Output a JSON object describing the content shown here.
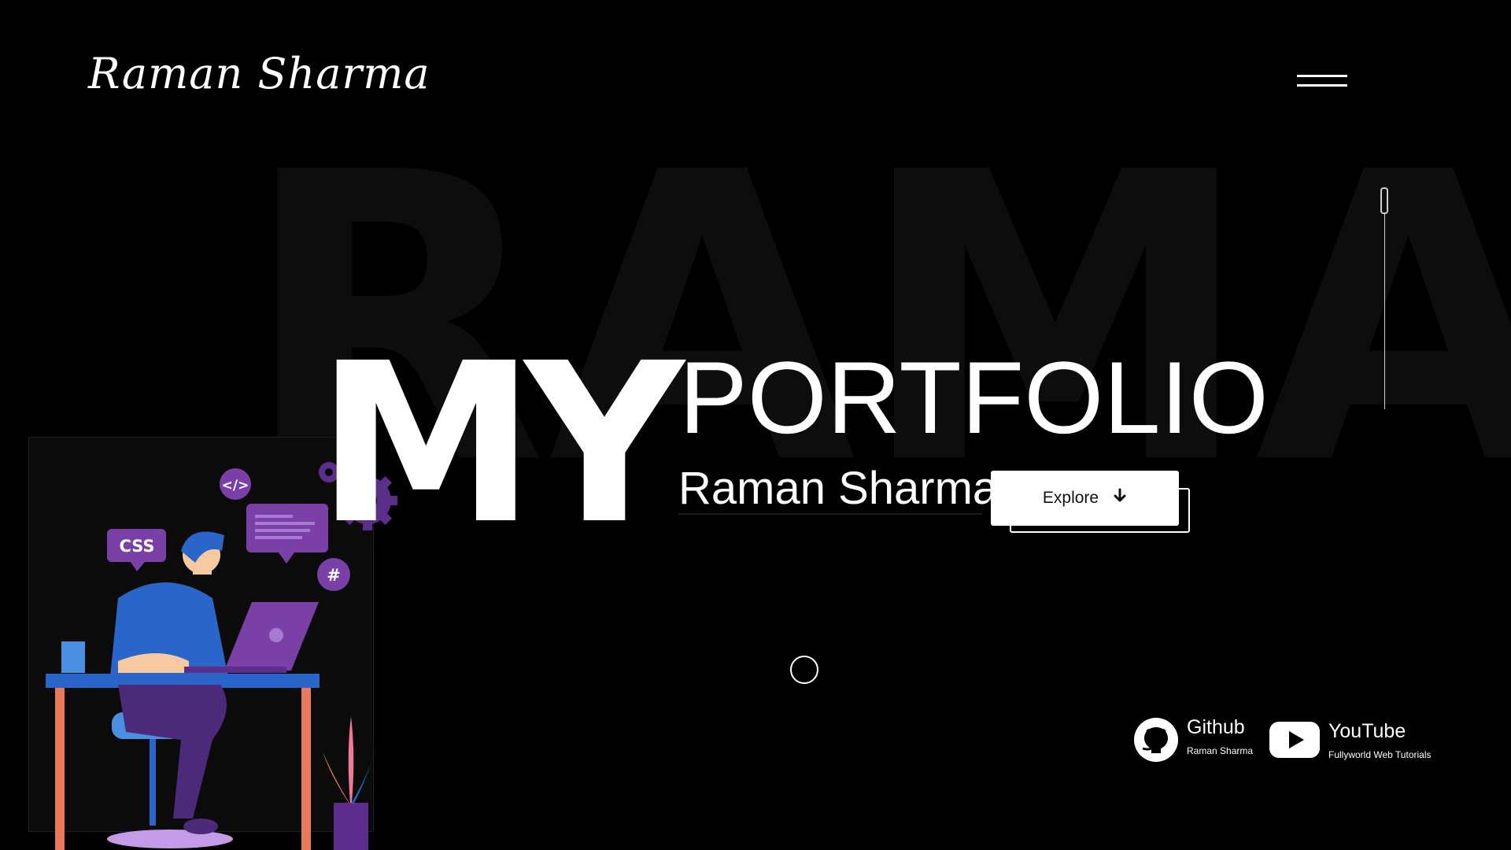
{
  "header": {
    "logo_text": "Raman Sharma",
    "menu_icon": "hamburger-menu-icon"
  },
  "background": {
    "watermark_text": "RAMAN"
  },
  "hero": {
    "title_big": "MY",
    "title_small": "PORTFOLIO",
    "name": "Raman Sharma",
    "explore_label": "Explore",
    "explore_icon": "arrow-down-icon"
  },
  "illustration": {
    "css_badge": "CSS",
    "code_badge": "</>",
    "hash_badge": "#"
  },
  "social": [
    {
      "icon": "github-icon",
      "title": "Github",
      "subtitle": "Raman Sharma"
    },
    {
      "icon": "youtube-icon",
      "title": "YouTube",
      "subtitle": "Fullyworld Web Tutorials"
    }
  ],
  "colors": {
    "background": "#000000",
    "text": "#ffffff",
    "watermark": "#0d0d0d",
    "accent_purple": "#7b3fa8",
    "accent_blue": "#2a66c9"
  }
}
